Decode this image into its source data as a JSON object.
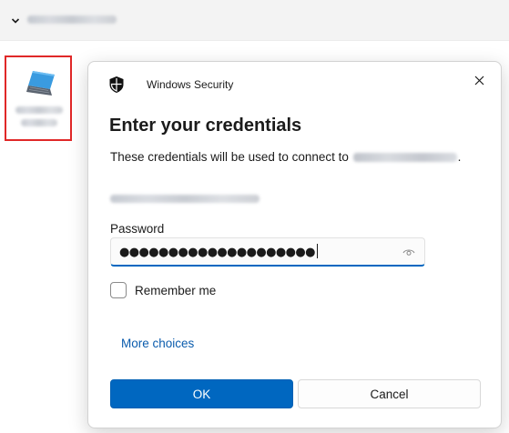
{
  "explorer": {
    "breadcrumb": "",
    "desktop_icon_label": ""
  },
  "dialog": {
    "app_title": "Windows Security",
    "heading": "Enter your credentials",
    "description_prefix": "These credentials will be used to connect to",
    "description_suffix": ".",
    "password_label": "Password",
    "password_value": "●●●●●●●●●●●●●●●●●●●●",
    "remember_label": "Remember me",
    "remember_checked": false,
    "more_choices": "More choices",
    "ok_label": "OK",
    "cancel_label": "Cancel"
  },
  "colors": {
    "accent": "#0067c0",
    "link": "#0b5cad",
    "highlight_border": "#e02828"
  }
}
